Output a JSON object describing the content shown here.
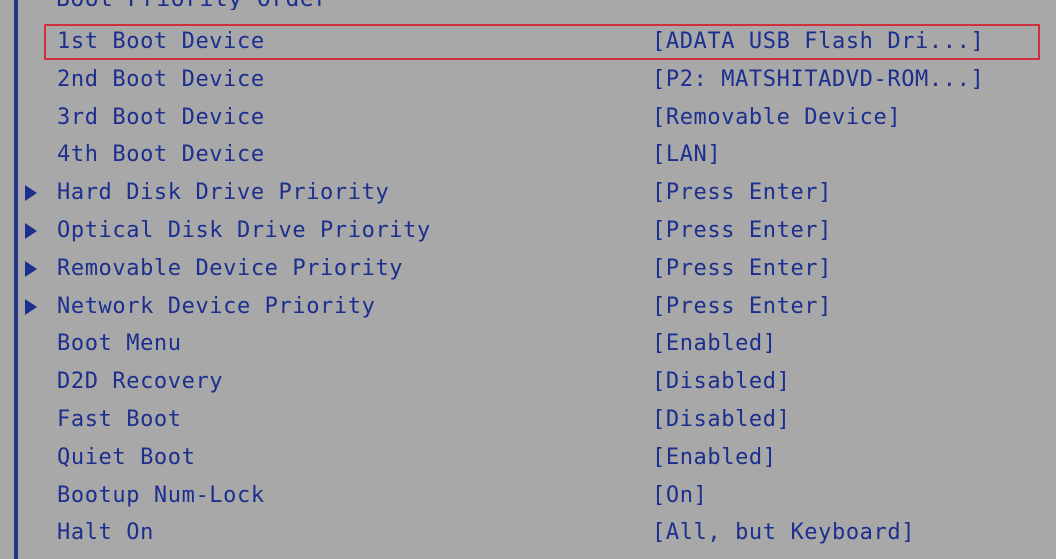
{
  "bios": {
    "header_fragment": "Boot Priority Order",
    "selected_index": 0,
    "items": [
      {
        "label": "1st Boot Device",
        "value": "[ADATA USB Flash Dri...]",
        "submenu": false
      },
      {
        "label": "2nd Boot Device",
        "value": "[P2: MATSHITADVD-ROM...]",
        "submenu": false
      },
      {
        "label": "3rd Boot Device",
        "value": "[Removable Device]",
        "submenu": false
      },
      {
        "label": "4th Boot Device",
        "value": "[LAN]",
        "submenu": false
      },
      {
        "label": "Hard Disk Drive Priority",
        "value": "[Press Enter]",
        "submenu": true
      },
      {
        "label": "Optical Disk Drive Priority",
        "value": "[Press Enter]",
        "submenu": true
      },
      {
        "label": "Removable Device Priority",
        "value": "[Press Enter]",
        "submenu": true
      },
      {
        "label": "Network Device Priority",
        "value": "[Press Enter]",
        "submenu": true
      },
      {
        "label": "Boot Menu",
        "value": "[Enabled]",
        "submenu": false
      },
      {
        "label": "D2D Recovery",
        "value": "[Disabled]",
        "submenu": false
      },
      {
        "label": "Fast Boot",
        "value": "[Disabled]",
        "submenu": false
      },
      {
        "label": "Quiet Boot",
        "value": "[Enabled]",
        "submenu": false
      },
      {
        "label": "Bootup Num-Lock",
        "value": "[On]",
        "submenu": false
      },
      {
        "label": "Halt On",
        "value": "[All, but Keyboard]",
        "submenu": false
      }
    ]
  },
  "colors": {
    "background": "#a8a8a8",
    "text": "#1c2e8e",
    "selection_border": "#d0303a",
    "frame_line": "#24308a"
  },
  "icons": {
    "submenu": "triangle-right-icon"
  }
}
